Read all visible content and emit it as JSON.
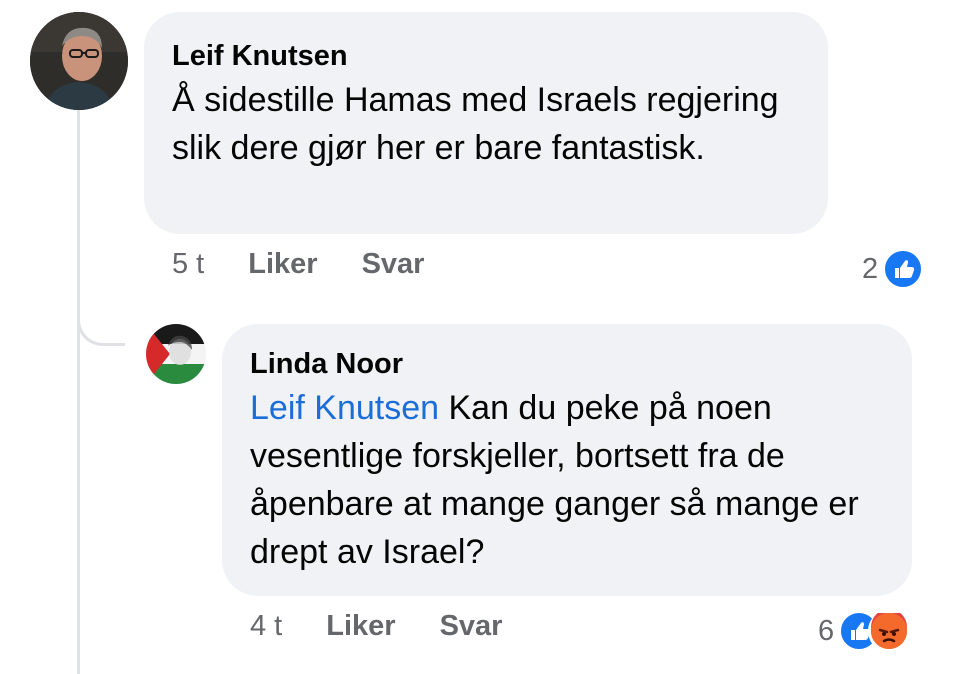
{
  "comments": [
    {
      "author": "Leif Knutsen",
      "text": "Å sidestille Hamas med Israels regjering slik dere gjør her er bare fantastisk.",
      "time": "5 t",
      "like_label": "Liker",
      "reply_label": "Svar",
      "reaction_count": "2",
      "reactions": [
        "like-icon"
      ]
    },
    {
      "author": "Linda Noor",
      "mention": "Leif Knutsen",
      "text": "Kan du peke på noen vesentlige forskjeller, bortsett fra de åpenbare at mange ganger så mange er drept av Israel?",
      "time": "4 t",
      "like_label": "Liker",
      "reply_label": "Svar",
      "reaction_count": "6",
      "reactions": [
        "like-icon",
        "angry-icon"
      ]
    }
  ],
  "colors": {
    "bubble": "#f0f2f5",
    "mention": "#1b6ed8",
    "meta": "#65676b",
    "like": "#1877f2",
    "angry": "#f36a2c"
  }
}
